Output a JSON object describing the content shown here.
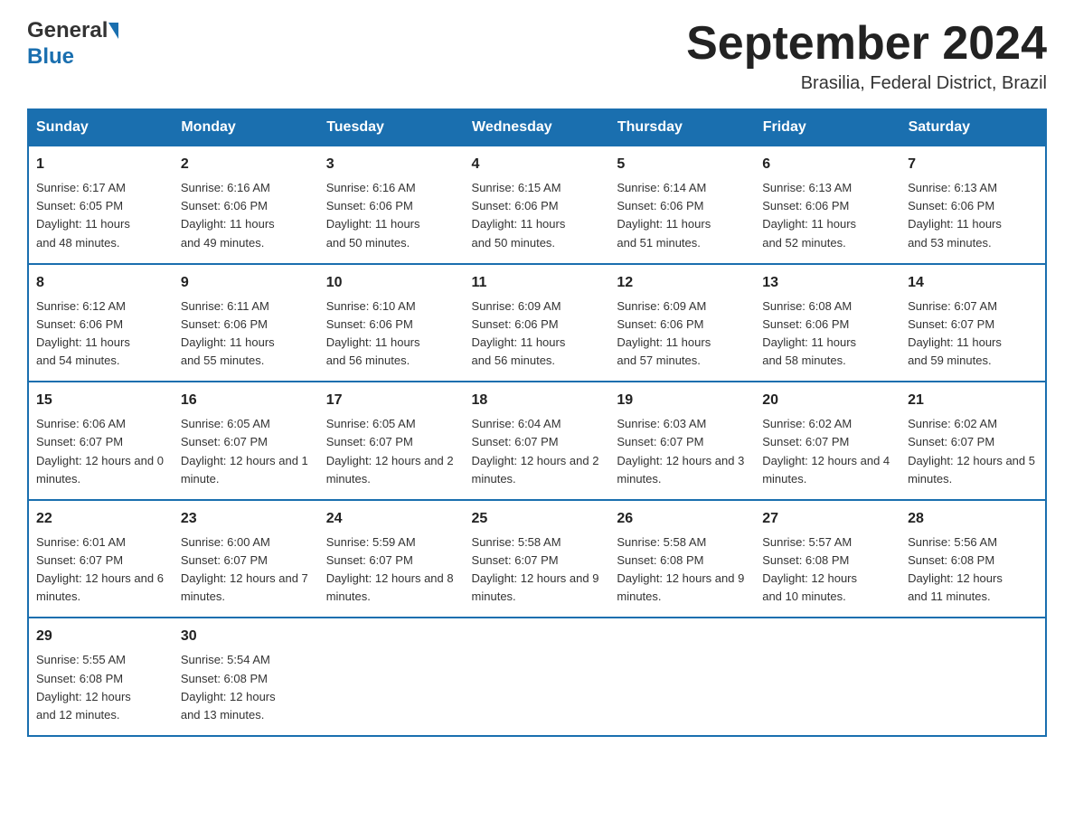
{
  "header": {
    "month_title": "September 2024",
    "location": "Brasilia, Federal District, Brazil",
    "logo_general": "General",
    "logo_blue": "Blue"
  },
  "calendar": {
    "days_of_week": [
      "Sunday",
      "Monday",
      "Tuesday",
      "Wednesday",
      "Thursday",
      "Friday",
      "Saturday"
    ],
    "weeks": [
      [
        {
          "day": "1",
          "sunrise": "6:17 AM",
          "sunset": "6:05 PM",
          "daylight": "11 hours and 48 minutes."
        },
        {
          "day": "2",
          "sunrise": "6:16 AM",
          "sunset": "6:06 PM",
          "daylight": "11 hours and 49 minutes."
        },
        {
          "day": "3",
          "sunrise": "6:16 AM",
          "sunset": "6:06 PM",
          "daylight": "11 hours and 50 minutes."
        },
        {
          "day": "4",
          "sunrise": "6:15 AM",
          "sunset": "6:06 PM",
          "daylight": "11 hours and 50 minutes."
        },
        {
          "day": "5",
          "sunrise": "6:14 AM",
          "sunset": "6:06 PM",
          "daylight": "11 hours and 51 minutes."
        },
        {
          "day": "6",
          "sunrise": "6:13 AM",
          "sunset": "6:06 PM",
          "daylight": "11 hours and 52 minutes."
        },
        {
          "day": "7",
          "sunrise": "6:13 AM",
          "sunset": "6:06 PM",
          "daylight": "11 hours and 53 minutes."
        }
      ],
      [
        {
          "day": "8",
          "sunrise": "6:12 AM",
          "sunset": "6:06 PM",
          "daylight": "11 hours and 54 minutes."
        },
        {
          "day": "9",
          "sunrise": "6:11 AM",
          "sunset": "6:06 PM",
          "daylight": "11 hours and 55 minutes."
        },
        {
          "day": "10",
          "sunrise": "6:10 AM",
          "sunset": "6:06 PM",
          "daylight": "11 hours and 56 minutes."
        },
        {
          "day": "11",
          "sunrise": "6:09 AM",
          "sunset": "6:06 PM",
          "daylight": "11 hours and 56 minutes."
        },
        {
          "day": "12",
          "sunrise": "6:09 AM",
          "sunset": "6:06 PM",
          "daylight": "11 hours and 57 minutes."
        },
        {
          "day": "13",
          "sunrise": "6:08 AM",
          "sunset": "6:06 PM",
          "daylight": "11 hours and 58 minutes."
        },
        {
          "day": "14",
          "sunrise": "6:07 AM",
          "sunset": "6:07 PM",
          "daylight": "11 hours and 59 minutes."
        }
      ],
      [
        {
          "day": "15",
          "sunrise": "6:06 AM",
          "sunset": "6:07 PM",
          "daylight": "12 hours and 0 minutes."
        },
        {
          "day": "16",
          "sunrise": "6:05 AM",
          "sunset": "6:07 PM",
          "daylight": "12 hours and 1 minute."
        },
        {
          "day": "17",
          "sunrise": "6:05 AM",
          "sunset": "6:07 PM",
          "daylight": "12 hours and 2 minutes."
        },
        {
          "day": "18",
          "sunrise": "6:04 AM",
          "sunset": "6:07 PM",
          "daylight": "12 hours and 2 minutes."
        },
        {
          "day": "19",
          "sunrise": "6:03 AM",
          "sunset": "6:07 PM",
          "daylight": "12 hours and 3 minutes."
        },
        {
          "day": "20",
          "sunrise": "6:02 AM",
          "sunset": "6:07 PM",
          "daylight": "12 hours and 4 minutes."
        },
        {
          "day": "21",
          "sunrise": "6:02 AM",
          "sunset": "6:07 PM",
          "daylight": "12 hours and 5 minutes."
        }
      ],
      [
        {
          "day": "22",
          "sunrise": "6:01 AM",
          "sunset": "6:07 PM",
          "daylight": "12 hours and 6 minutes."
        },
        {
          "day": "23",
          "sunrise": "6:00 AM",
          "sunset": "6:07 PM",
          "daylight": "12 hours and 7 minutes."
        },
        {
          "day": "24",
          "sunrise": "5:59 AM",
          "sunset": "6:07 PM",
          "daylight": "12 hours and 8 minutes."
        },
        {
          "day": "25",
          "sunrise": "5:58 AM",
          "sunset": "6:07 PM",
          "daylight": "12 hours and 9 minutes."
        },
        {
          "day": "26",
          "sunrise": "5:58 AM",
          "sunset": "6:08 PM",
          "daylight": "12 hours and 9 minutes."
        },
        {
          "day": "27",
          "sunrise": "5:57 AM",
          "sunset": "6:08 PM",
          "daylight": "12 hours and 10 minutes."
        },
        {
          "day": "28",
          "sunrise": "5:56 AM",
          "sunset": "6:08 PM",
          "daylight": "12 hours and 11 minutes."
        }
      ],
      [
        {
          "day": "29",
          "sunrise": "5:55 AM",
          "sunset": "6:08 PM",
          "daylight": "12 hours and 12 minutes."
        },
        {
          "day": "30",
          "sunrise": "5:54 AM",
          "sunset": "6:08 PM",
          "daylight": "12 hours and 13 minutes."
        },
        null,
        null,
        null,
        null,
        null
      ]
    ],
    "labels": {
      "sunrise": "Sunrise:",
      "sunset": "Sunset:",
      "daylight": "Daylight:"
    }
  }
}
